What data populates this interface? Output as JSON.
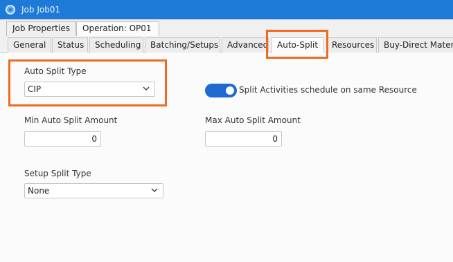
{
  "window": {
    "title": "Job Job01"
  },
  "outer_tabs": [
    {
      "label": "Job Properties",
      "active": false
    },
    {
      "label": "Operation: OP01",
      "active": true
    }
  ],
  "inner_tabs": [
    {
      "label": "General",
      "active": false
    },
    {
      "label": "Status",
      "active": false
    },
    {
      "label": "Scheduling",
      "active": false
    },
    {
      "label": "Batching/Setups",
      "active": false
    },
    {
      "label": "Advanced",
      "active": false
    },
    {
      "label": "Auto-Split",
      "active": true
    },
    {
      "label": "Resources",
      "active": false
    },
    {
      "label": "Buy-Direct Materi",
      "active": false
    }
  ],
  "form": {
    "auto_split_type": {
      "label": "Auto Split Type",
      "value": "CIP"
    },
    "split_activities_toggle": {
      "label": "Split Activities schedule on same Resource",
      "on": true
    },
    "min_auto_split_amount": {
      "label": "Min Auto Split Amount",
      "value": "0"
    },
    "max_auto_split_amount": {
      "label": "Max Auto Split Amount",
      "value": "0"
    },
    "setup_split_type": {
      "label": "Setup Split Type",
      "value": "None"
    }
  },
  "colors": {
    "titlebar": "#1e7ad6",
    "highlight": "#ef6a1f",
    "toggle_on": "#1e6ad0"
  }
}
